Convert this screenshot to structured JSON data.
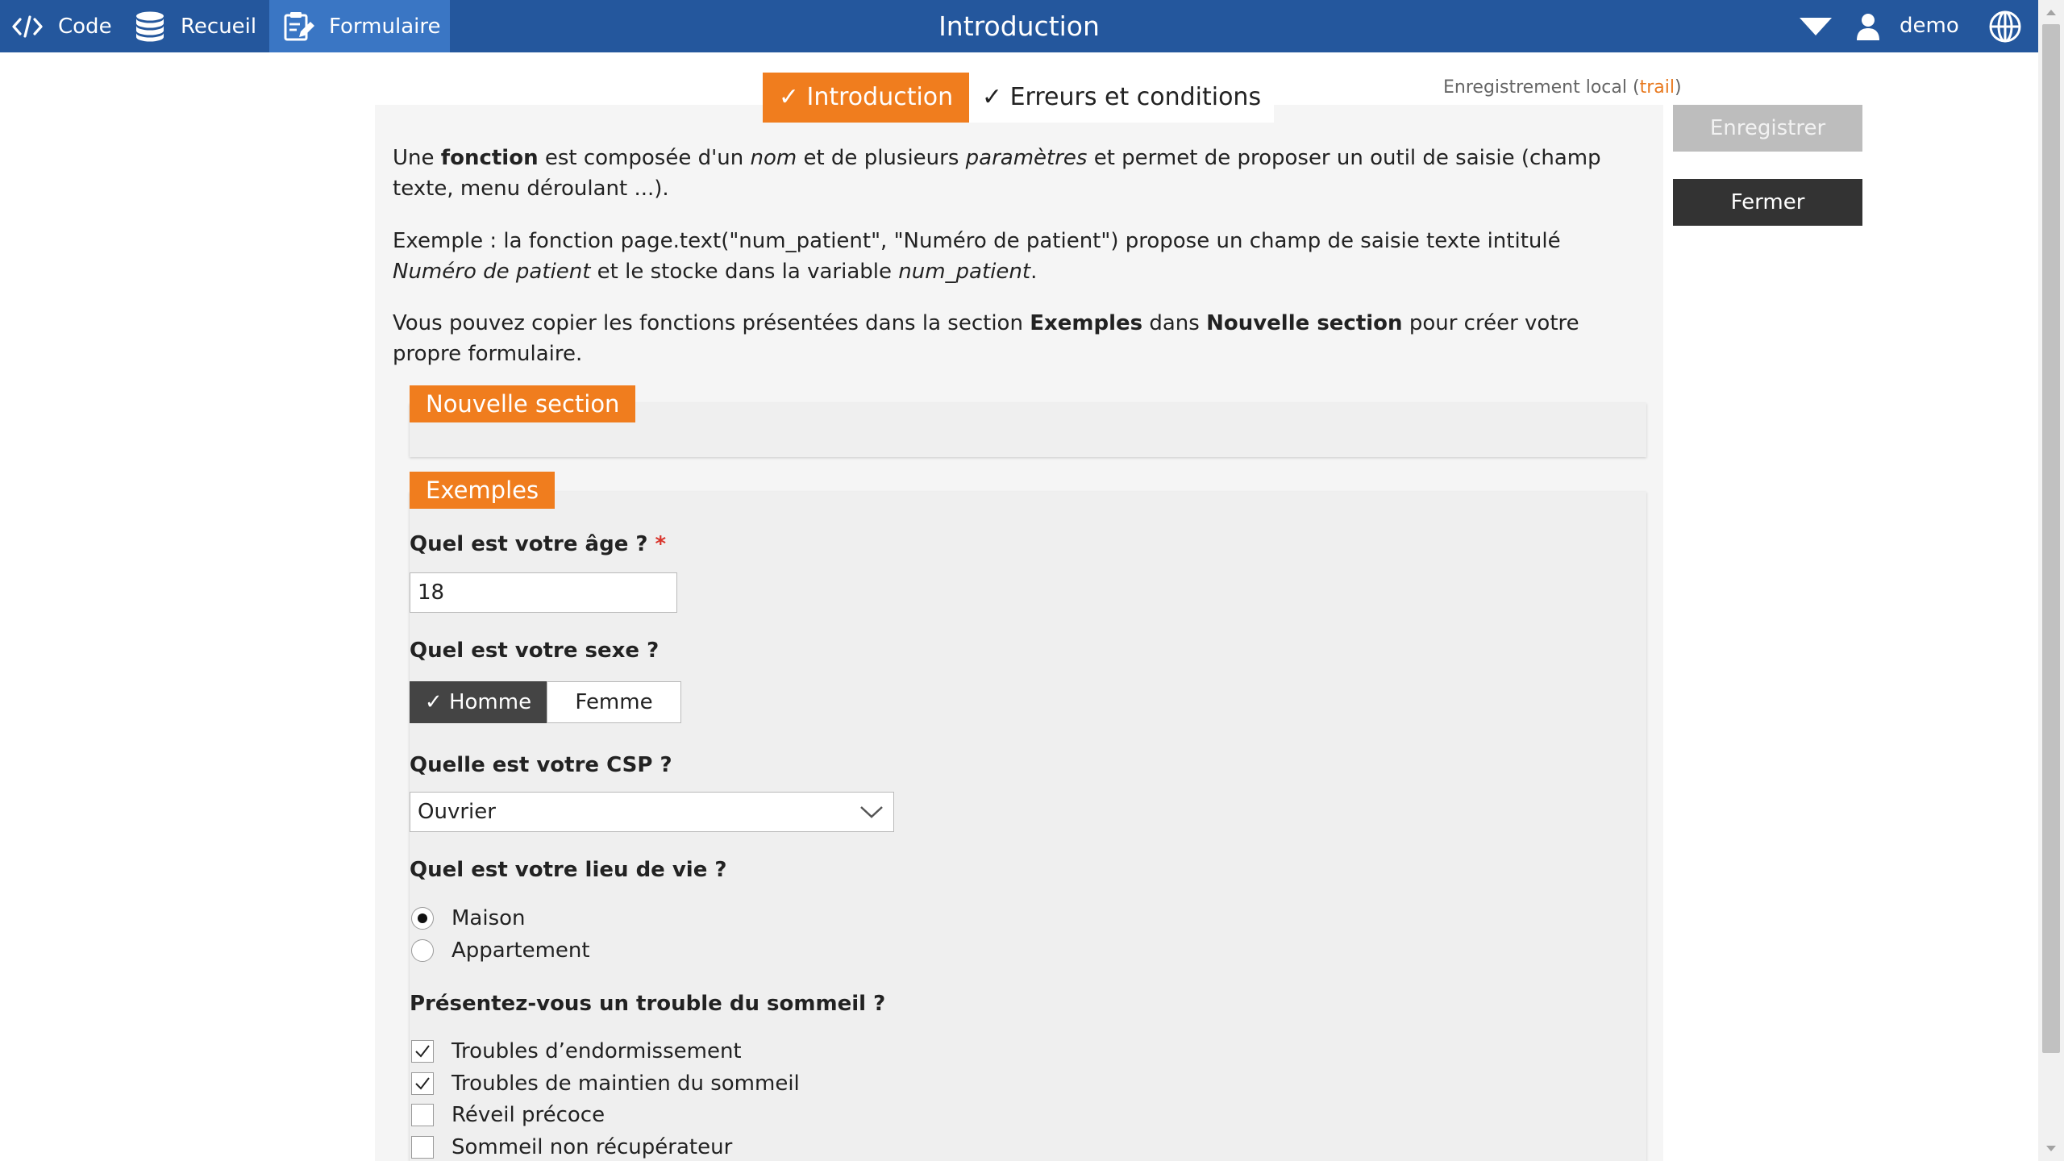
{
  "nav": {
    "code": "Code",
    "recueil": "Recueil",
    "formulaire": "Formulaire",
    "title": "Introduction",
    "user": "demo"
  },
  "tabs": {
    "introduction": "✓ Introduction",
    "erreurs": "✓ Erreurs et conditions"
  },
  "local_save": {
    "prefix": "Enregistrement local (",
    "highlight": "trail",
    "suffix": ")"
  },
  "intro": {
    "p1": {
      "a": "Une ",
      "b": "fonction",
      "c": " est composée d'un ",
      "d": "nom",
      "e": " et de plusieurs ",
      "f": "paramètres",
      "g": " et permet de proposer un outil de saisie (champ texte, menu déroulant ...)."
    },
    "p2": {
      "a": "Exemple : la fonction page.text(\"num_patient\", \"Numéro de patient\") propose un champ de saisie texte intitulé ",
      "b": "Numéro de patient",
      "c": " et le stocke dans la variable ",
      "d": "num_patient",
      "e": "."
    },
    "p3": {
      "a": "Vous pouvez copier les fonctions présentées dans la section ",
      "b": "Exemples",
      "c": " dans ",
      "d": "Nouvelle section",
      "e": " pour créer votre propre formulaire."
    }
  },
  "sections": {
    "new": "Nouvelle section",
    "examples": "Exemples"
  },
  "form": {
    "age": {
      "label": "Quel est votre âge ? ",
      "required": "*",
      "value": "18"
    },
    "sexe": {
      "label": "Quel est votre sexe ?",
      "option_homme": "✓ Homme",
      "option_femme": "Femme"
    },
    "csp": {
      "label": "Quelle est votre CSP ?",
      "value": "Ouvrier"
    },
    "lieu": {
      "label": "Quel est votre lieu de vie ?",
      "maison": "Maison",
      "appartement": "Appartement"
    },
    "sommeil": {
      "label": "Présentez-vous un trouble du sommeil ?",
      "options": [
        {
          "label": "Troubles d’endormissement",
          "checked": true
        },
        {
          "label": "Troubles de maintien du sommeil",
          "checked": true
        },
        {
          "label": "Réveil précoce",
          "checked": false
        },
        {
          "label": "Sommeil non récupérateur",
          "checked": false
        }
      ]
    }
  },
  "buttons": {
    "save": "Enregistrer",
    "close": "Fermer"
  },
  "colors": {
    "topbar": "#24579d",
    "topbar_active": "#3a76c4",
    "accent": "#f07d1e"
  }
}
